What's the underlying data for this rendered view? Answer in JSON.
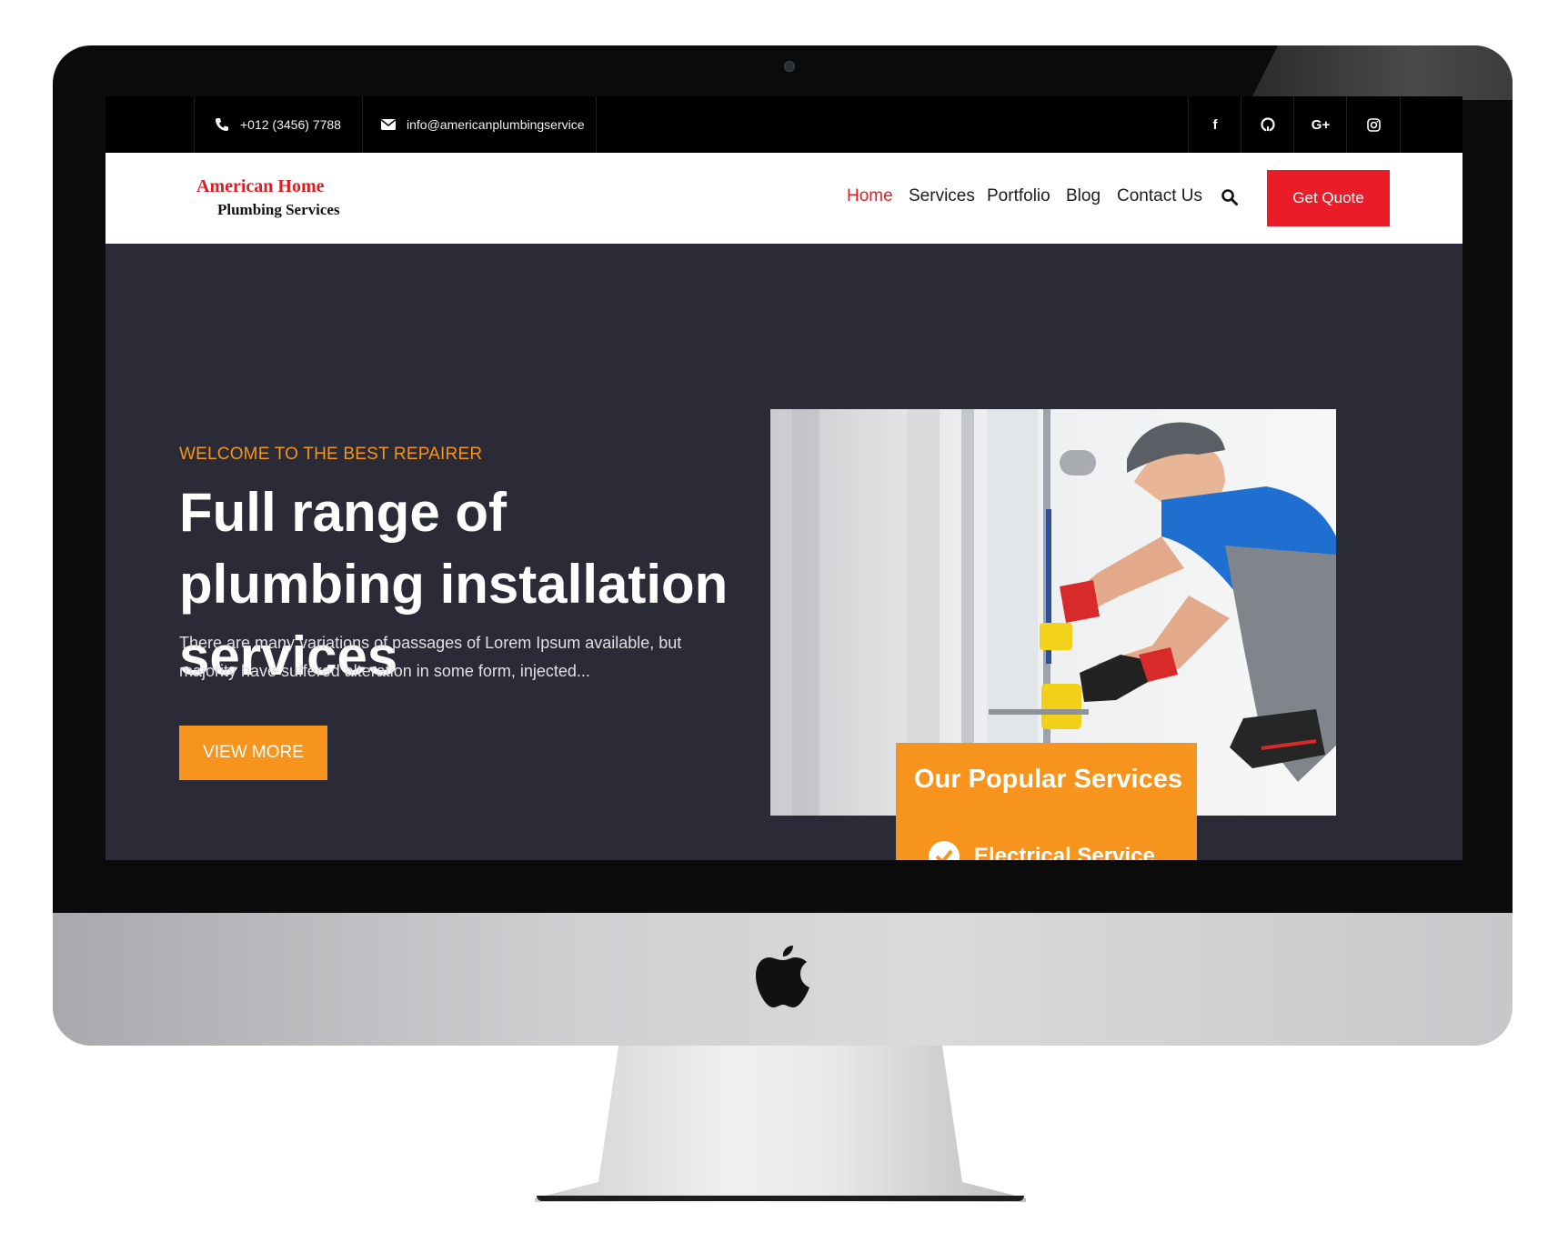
{
  "topbar": {
    "phone": "+012 (3456) 7788",
    "email": "info@americanplumbingservice",
    "social": [
      "f",
      "G+"
    ]
  },
  "brand": {
    "line1": "American Home",
    "line2": "Plumbing Services"
  },
  "nav": {
    "items": [
      "Home",
      "Services",
      "Portfolio",
      "Blog",
      "Contact Us"
    ],
    "active": "Home",
    "cta": "Get Quote"
  },
  "hero": {
    "eyebrow": "WELCOME TO THE BEST REPAIRER",
    "title": "Full range of plumbing installation services",
    "text": "There are many variations of passages of Lorem Ipsum available, but majority have suffered alteration in some form, injected...",
    "button": "VIEW MORE"
  },
  "popular": {
    "title": "Our Popular Services",
    "items": [
      "Electrical Service"
    ]
  },
  "colors": {
    "accent_orange": "#f7941d",
    "accent_red": "#ea1c27",
    "hero_bg": "#2a2b36"
  }
}
